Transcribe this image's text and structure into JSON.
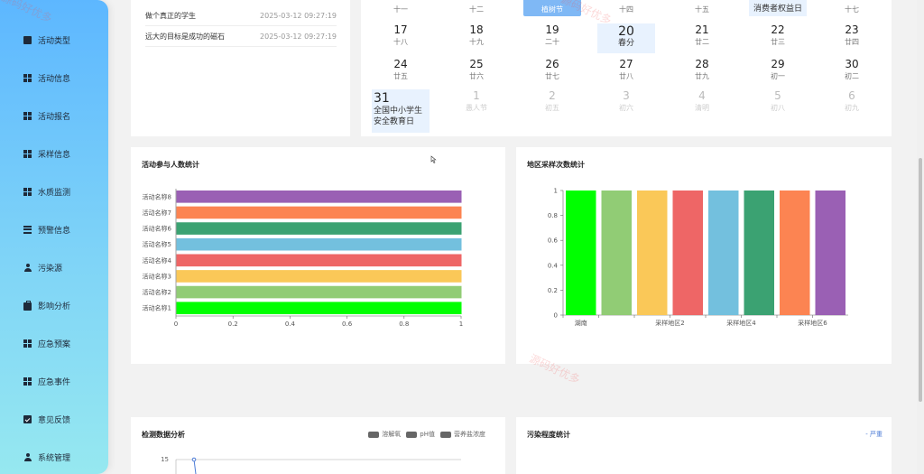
{
  "sidebar": {
    "items": [
      {
        "label": "活动类型",
        "icon": "book-icon"
      },
      {
        "label": "活动信息",
        "icon": "grid-icon"
      },
      {
        "label": "活动报名",
        "icon": "grid-icon"
      },
      {
        "label": "采样信息",
        "icon": "grid-icon"
      },
      {
        "label": "水质监测",
        "icon": "grid-icon"
      },
      {
        "label": "预警信息",
        "icon": "list-icon"
      },
      {
        "label": "污染源",
        "icon": "user-icon"
      },
      {
        "label": "影响分析",
        "icon": "briefcase-icon"
      },
      {
        "label": "应急预案",
        "icon": "grid-icon"
      },
      {
        "label": "应急事件",
        "icon": "grid-icon"
      },
      {
        "label": "意见反馈",
        "icon": "clipboard-icon"
      },
      {
        "label": "系统管理",
        "icon": "user-icon"
      }
    ]
  },
  "news": [
    {
      "title": "做个真正的学生",
      "date": "2025-03-12 09:27:19"
    },
    {
      "title": "远大的目标是成功的磁石",
      "date": "2025-03-12 09:27:19"
    }
  ],
  "calendar": {
    "top_row": [
      {
        "lunar": "十一"
      },
      {
        "lunar": "十二"
      },
      {
        "lunar": "植树节"
      },
      {
        "lunar": "十四"
      },
      {
        "lunar": "十五"
      },
      {
        "lunar": "消费者权益日"
      },
      {
        "lunar": "十七"
      }
    ],
    "rows": [
      [
        {
          "n": "17",
          "l": "十八"
        },
        {
          "n": "18",
          "l": "十九"
        },
        {
          "n": "19",
          "l": "二十"
        },
        {
          "n": "20",
          "l": "春分"
        },
        {
          "n": "21",
          "l": "廿二"
        },
        {
          "n": "22",
          "l": "廿三"
        },
        {
          "n": "23",
          "l": "廿四"
        }
      ],
      [
        {
          "n": "24",
          "l": "廿五"
        },
        {
          "n": "25",
          "l": "廿六"
        },
        {
          "n": "26",
          "l": "廿七"
        },
        {
          "n": "27",
          "l": "廿八"
        },
        {
          "n": "28",
          "l": "廿九"
        },
        {
          "n": "29",
          "l": "初一"
        },
        {
          "n": "30",
          "l": "初二"
        }
      ],
      [
        {
          "n": "31",
          "l1": "全国中小学生",
          "l2": "安全教育日"
        },
        {
          "n": "1",
          "l": "愚人节"
        },
        {
          "n": "2",
          "l": "初五"
        },
        {
          "n": "3",
          "l": "初六"
        },
        {
          "n": "4",
          "l": "清明"
        },
        {
          "n": "5",
          "l": "初八"
        },
        {
          "n": "6",
          "l": "初九"
        }
      ]
    ]
  },
  "participation_chart": {
    "title": "活动参与人数统计"
  },
  "region_chart": {
    "title": "地区采样次数统计"
  },
  "monitor_chart": {
    "title": "检测数据分析",
    "legend": [
      "溶解氧",
      "pH值",
      "营养盐浓度"
    ],
    "y_tick_top": "15"
  },
  "pollution_chart": {
    "title": "污染程度统计",
    "legend": [
      "严重"
    ]
  },
  "watermarks": [
    "源码好优多",
    "源码好优多",
    "源码好优多"
  ],
  "chart_data": [
    {
      "type": "bar",
      "orientation": "horizontal",
      "title": "活动参与人数统计",
      "categories": [
        "活动名称1",
        "活动名称2",
        "活动名称3",
        "活动名称4",
        "活动名称5",
        "活动名称6",
        "活动名称7",
        "活动名称8"
      ],
      "values": [
        1,
        1,
        1,
        1,
        1,
        1,
        1,
        1
      ],
      "colors": [
        "#00ff00",
        "#91cc75",
        "#fac858",
        "#ee6666",
        "#73c0de",
        "#3ba272",
        "#fc8452",
        "#9a60b4"
      ],
      "xlim": [
        0,
        1
      ],
      "xticks": [
        "0",
        "0.2",
        "0.4",
        "0.6",
        "0.8",
        "1"
      ]
    },
    {
      "type": "bar",
      "title": "地区采样次数统计",
      "categories": [
        "湖南",
        "",
        "采样地区2",
        "",
        "采样地区4",
        "",
        "采样地区6",
        ""
      ],
      "values": [
        1,
        1,
        1,
        1,
        1,
        1,
        1,
        1
      ],
      "colors": [
        "#00ff00",
        "#91cc75",
        "#fac858",
        "#ee6666",
        "#73c0de",
        "#3ba272",
        "#fc8452",
        "#9a60b4"
      ],
      "ylim": [
        0,
        1
      ],
      "yticks": [
        "0",
        "0.2",
        "0.4",
        "0.6",
        "0.8",
        "1"
      ]
    }
  ]
}
